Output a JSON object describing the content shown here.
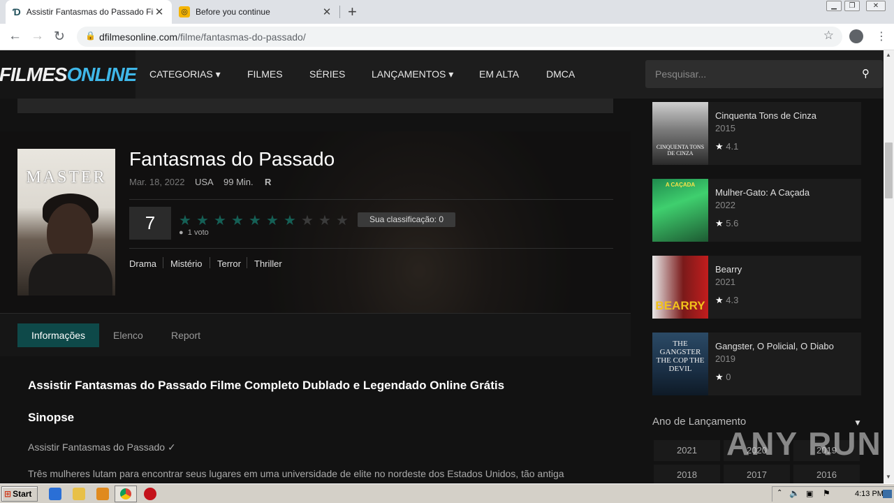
{
  "browser": {
    "tabs": [
      {
        "title": "Assistir Fantasmas do Passado Filme",
        "active": true
      },
      {
        "title": "Before you continue",
        "active": false
      }
    ],
    "url_host": "dfilmesonline.com",
    "url_path": "/filme/fantasmas-do-passado/"
  },
  "site": {
    "logo": {
      "part1": "FILMES",
      "part2": "ONLINE"
    },
    "menu": [
      "CATEGORIAS ▾",
      "FILMES",
      "SÉRIES",
      "LANÇAMENTOS ▾",
      "EM ALTA",
      "DMCA"
    ],
    "search_placeholder": "Pesquisar..."
  },
  "movie": {
    "poster_text": "MASTER",
    "title": "Fantasmas do Passado",
    "date": "Mar. 18, 2022",
    "country": "USA",
    "duration": "99 Min.",
    "rating_cert": "R",
    "score": "7",
    "stars_filled": 7,
    "stars_total": 10,
    "votes": "1 voto",
    "your_rating": "Sua classificação: 0",
    "genres": [
      "Drama",
      "Mistério",
      "Terror",
      "Thriller"
    ]
  },
  "info_tabs": [
    "Informações",
    "Elenco",
    "Report"
  ],
  "content": {
    "heading": "Assistir Fantasmas do Passado Filme Completo Dublado e Legendado Online Grátis",
    "sinopse_heading": "Sinopse",
    "line1": "Assistir Fantasmas do Passado ✓",
    "line2": "Três mulheres lutam para encontrar seus lugares em uma universidade de elite no nordeste dos Estados Unidos, tão antiga"
  },
  "sidebar": {
    "items": [
      {
        "title": "Cinquenta Tons de Cinza",
        "year": "2015",
        "rating": "4.1",
        "thumb_text": "CINQUENTA TONS DE CINZA"
      },
      {
        "title": "Mulher-Gato: A Caçada",
        "year": "2022",
        "rating": "5.6",
        "thumb_text": "A CAÇADA"
      },
      {
        "title": "Bearry",
        "year": "2021",
        "rating": "4.3",
        "thumb_text": "BEARRY"
      },
      {
        "title": "Gangster, O Policial, O Diabo",
        "year": "2019",
        "rating": "0",
        "thumb_text": "THE GANGSTER THE COP THE DEVIL"
      }
    ],
    "year_title": "Ano de Lançamento",
    "years": [
      "2021",
      "2020",
      "2019",
      "2018",
      "2017",
      "2016"
    ]
  },
  "watermark": "ANY RUN",
  "taskbar": {
    "start": "Start",
    "clock": "4:13 PM"
  }
}
